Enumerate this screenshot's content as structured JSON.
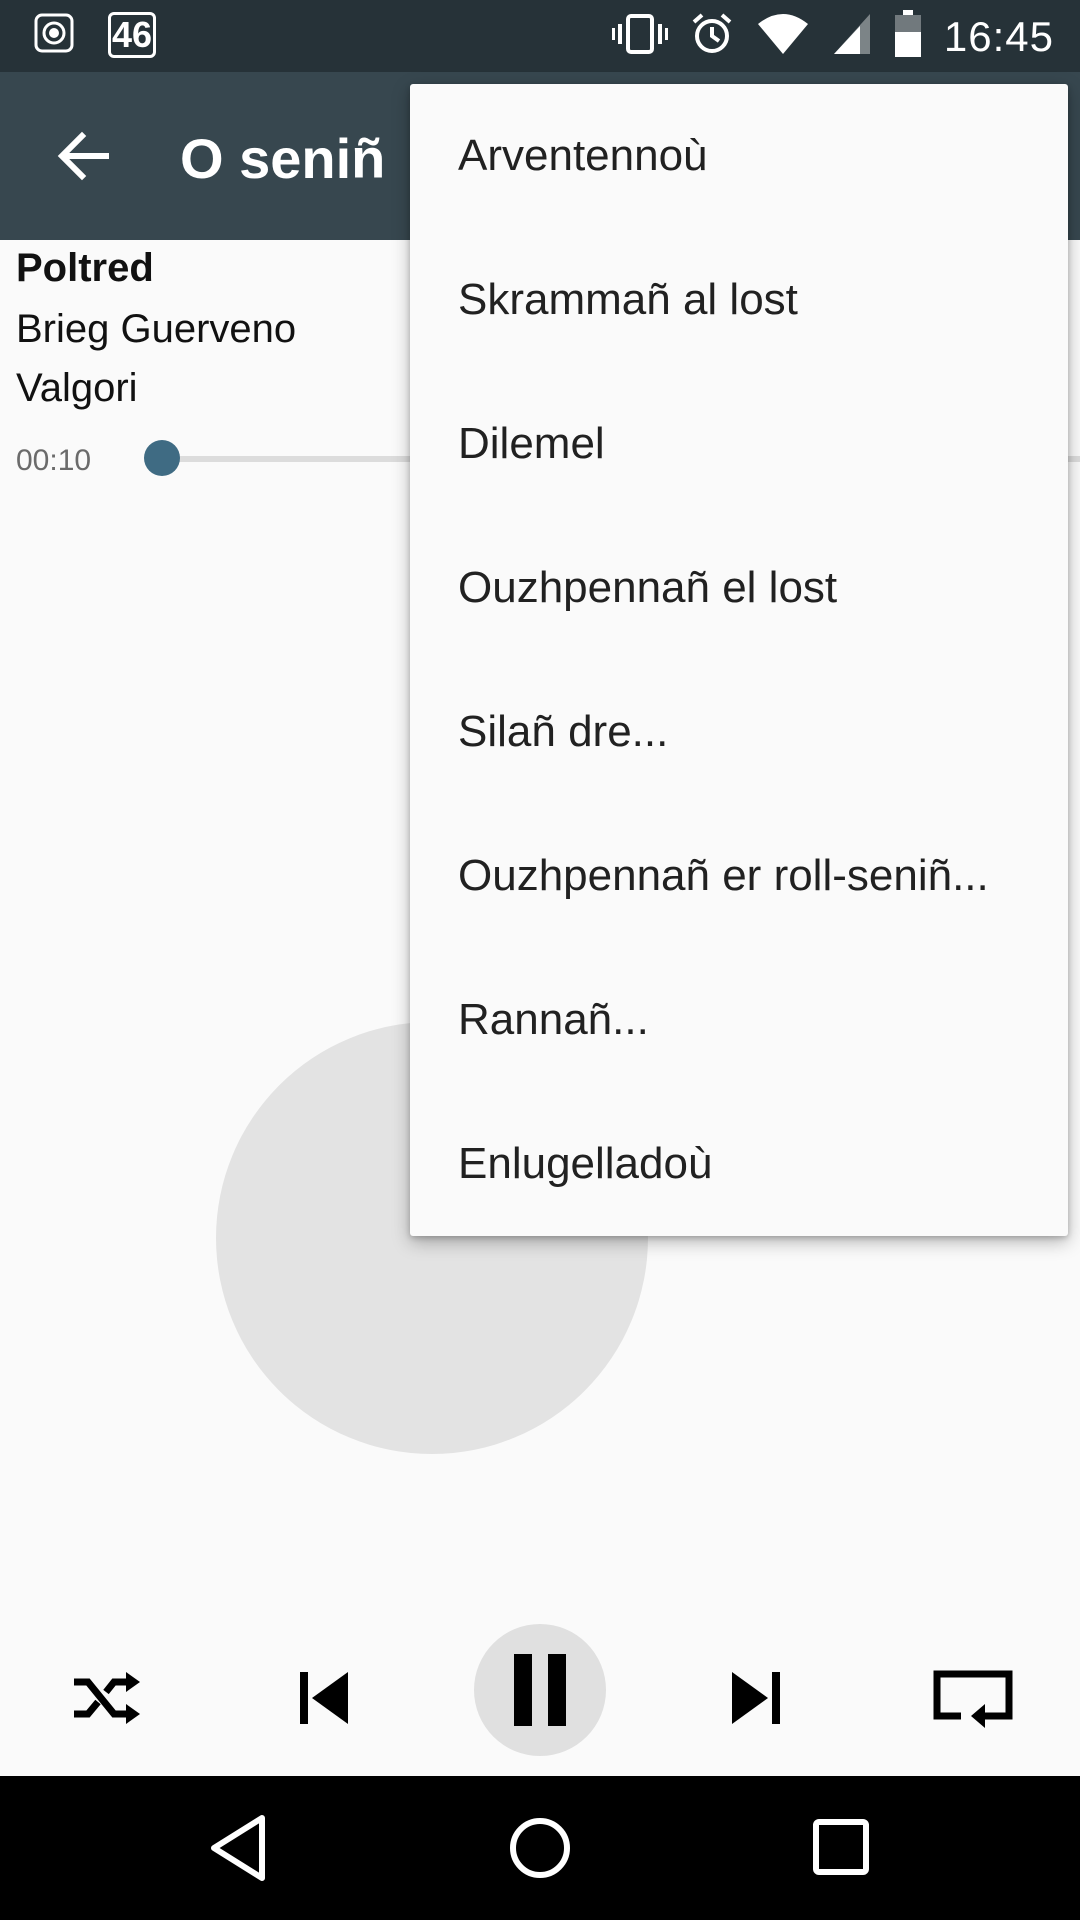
{
  "status_bar": {
    "notification_count": "46",
    "time": "16:45",
    "icons": [
      "record-icon",
      "notification-count-icon",
      "vibrate-icon",
      "alarm-icon",
      "wifi-icon",
      "cell-signal-icon",
      "battery-icon"
    ]
  },
  "app_bar": {
    "title": "O seniñ",
    "back_icon": "arrow-back-icon"
  },
  "track": {
    "title": "Poltred",
    "artist": "Brieg Guerveno",
    "album": "Valgori"
  },
  "seek": {
    "current_time": "00:10",
    "progress": 0.0
  },
  "overflow_menu": {
    "items": [
      {
        "label": "Arventennoù"
      },
      {
        "label": "Skrammañ al lost"
      },
      {
        "label": "Dilemel"
      },
      {
        "label": "Ouzhpennañ el lost"
      },
      {
        "label": "Silañ dre..."
      },
      {
        "label": "Ouzhpennañ er roll-seniñ..."
      },
      {
        "label": "Rannañ..."
      },
      {
        "label": "Enlugelladoù"
      }
    ]
  },
  "playback_controls": {
    "icons": [
      "shuffle-icon",
      "skip-previous-icon",
      "pause-icon",
      "skip-next-icon",
      "repeat-icon"
    ]
  },
  "nav_bar": {
    "icons": [
      "nav-back-icon",
      "nav-home-icon",
      "nav-recents-icon"
    ]
  },
  "colors": {
    "status_bar": "#263238",
    "app_bar": "#37474f",
    "accent": "#3f6b83",
    "background": "#fafafa",
    "nav_bar": "#000000"
  }
}
